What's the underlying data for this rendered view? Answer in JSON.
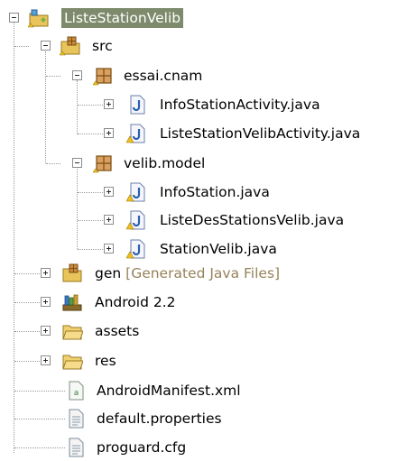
{
  "colors": {
    "selection_bg": "#7d8a6b",
    "decoration_text": "#968259",
    "tree_line": "#9a9a9a"
  },
  "tree": {
    "project": {
      "label": "ListeStationVelib",
      "icon": "android-project-icon",
      "state": "expanded",
      "selected": true
    },
    "src": {
      "label": "src",
      "icon": "source-folder-icon",
      "state": "expanded"
    },
    "pkg1": {
      "label": "essai.cnam",
      "icon": "package-icon",
      "state": "expanded"
    },
    "file1": {
      "label": "InfoStationActivity.java",
      "icon": "java-file-icon",
      "state": "collapsed"
    },
    "file2": {
      "label": "ListeStationVelibActivity.java",
      "icon": "java-file-warning-icon",
      "state": "collapsed"
    },
    "pkg2": {
      "label": "velib.model",
      "icon": "package-icon",
      "state": "expanded"
    },
    "file3": {
      "label": "InfoStation.java",
      "icon": "java-file-warning-icon",
      "state": "collapsed"
    },
    "file4": {
      "label": "ListeDesStationsVelib.java",
      "icon": "java-file-warning-icon",
      "state": "collapsed"
    },
    "file5": {
      "label": "StationVelib.java",
      "icon": "java-file-warning-icon",
      "state": "collapsed"
    },
    "gen": {
      "label": "gen",
      "decoration": "[Generated Java Files]",
      "icon": "generated-folder-icon",
      "state": "collapsed"
    },
    "android": {
      "label": "Android 2.2",
      "icon": "library-icon",
      "state": "collapsed"
    },
    "assets": {
      "label": "assets",
      "icon": "folder-icon",
      "state": "collapsed"
    },
    "res": {
      "label": "res",
      "icon": "folder-icon",
      "state": "collapsed"
    },
    "manifest": {
      "label": "AndroidManifest.xml",
      "icon": "xml-file-icon"
    },
    "props": {
      "label": "default.properties",
      "icon": "text-file-icon"
    },
    "proguard": {
      "label": "proguard.cfg",
      "icon": "text-file-icon"
    }
  }
}
